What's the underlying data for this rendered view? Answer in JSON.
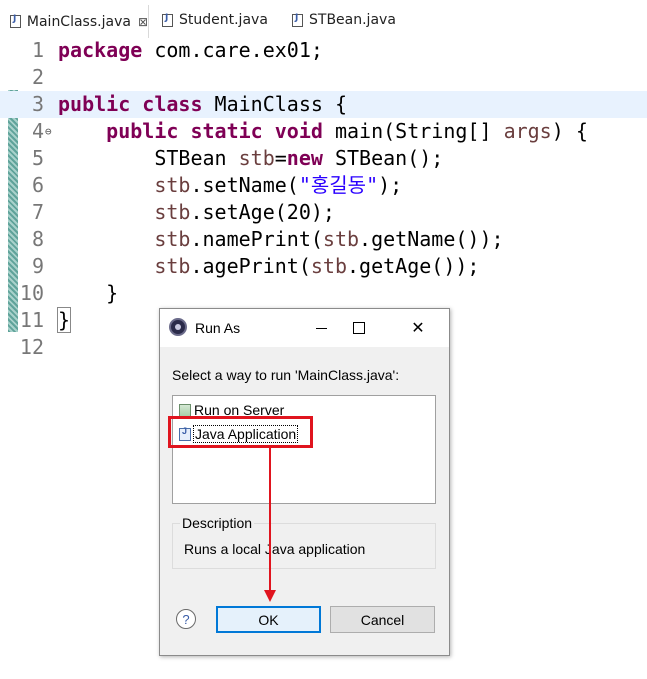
{
  "tabs": [
    {
      "label": "MainClass.java",
      "active": true,
      "close": "⊠"
    },
    {
      "label": "Student.java",
      "active": false
    },
    {
      "label": "STBean.java",
      "active": false
    }
  ],
  "editor": {
    "lines": [
      {
        "num": "1",
        "tokens": [
          {
            "t": "package",
            "k": "kw"
          },
          {
            "t": " com.care.ex01;"
          }
        ]
      },
      {
        "num": "2",
        "tokens": []
      },
      {
        "num": "3",
        "tokens": [
          {
            "t": "public",
            "k": "kw"
          },
          {
            "t": " "
          },
          {
            "t": "class",
            "k": "kw"
          },
          {
            "t": " MainClass {"
          }
        ]
      },
      {
        "num": "4",
        "fold": "⊖",
        "tokens": [
          {
            "t": "    "
          },
          {
            "t": "public",
            "k": "kw"
          },
          {
            "t": " "
          },
          {
            "t": "static",
            "k": "kw"
          },
          {
            "t": " "
          },
          {
            "t": "void",
            "k": "kw"
          },
          {
            "t": " main(String[] "
          },
          {
            "t": "args",
            "k": "var"
          },
          {
            "t": ") {"
          }
        ]
      },
      {
        "num": "5",
        "tokens": [
          {
            "t": "        STBean "
          },
          {
            "t": "stb",
            "k": "var"
          },
          {
            "t": "="
          },
          {
            "t": "new",
            "k": "kw"
          },
          {
            "t": " STBean();"
          }
        ]
      },
      {
        "num": "6",
        "tokens": [
          {
            "t": "        "
          },
          {
            "t": "stb",
            "k": "var"
          },
          {
            "t": ".setName("
          },
          {
            "t": "\"홍길동\"",
            "k": "str"
          },
          {
            "t": ");"
          }
        ]
      },
      {
        "num": "7",
        "tokens": [
          {
            "t": "        "
          },
          {
            "t": "stb",
            "k": "var"
          },
          {
            "t": ".setAge(20);"
          }
        ]
      },
      {
        "num": "8",
        "tokens": [
          {
            "t": "        "
          },
          {
            "t": "stb",
            "k": "var"
          },
          {
            "t": ".namePrint("
          },
          {
            "t": "stb",
            "k": "var"
          },
          {
            "t": ".getName());"
          }
        ]
      },
      {
        "num": "9",
        "tokens": [
          {
            "t": "        "
          },
          {
            "t": "stb",
            "k": "var"
          },
          {
            "t": ".agePrint("
          },
          {
            "t": "stb",
            "k": "var"
          },
          {
            "t": ".getAge());"
          }
        ]
      },
      {
        "num": "10",
        "tokens": [
          {
            "t": "    }"
          }
        ]
      },
      {
        "num": "11",
        "tokens": [
          {
            "t": "}",
            "k": "box"
          }
        ]
      },
      {
        "num": "12",
        "tokens": []
      }
    ]
  },
  "dialog": {
    "title": "Run As",
    "minimize": "minimize",
    "maximize": "maximize",
    "close": "✕",
    "prompt": "Select a way to run 'MainClass.java':",
    "options": [
      {
        "label": "Run on Server",
        "icon": "server-icon",
        "selected": false
      },
      {
        "label": "Java Application",
        "icon": "java-file-icon",
        "selected": true
      }
    ],
    "description_title": "Description",
    "description_text": "Runs a local Java application",
    "help": "?",
    "ok_label": "OK",
    "cancel_label": "Cancel"
  },
  "colors": {
    "keyword": "#7f0055",
    "string": "#2a00ff",
    "variable": "#6a3e3e",
    "annotation_red": "#e0141e",
    "current_line": "#e8f2fe"
  }
}
